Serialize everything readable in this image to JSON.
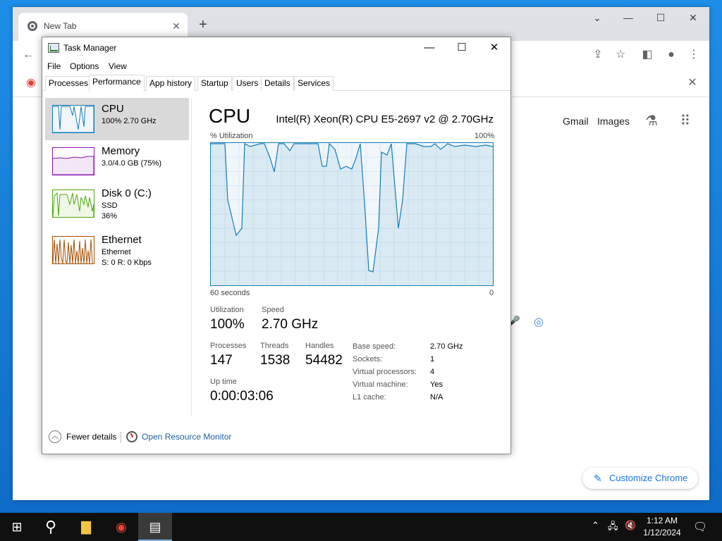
{
  "chrome": {
    "tab_title": "New Tab",
    "new_tab": "+",
    "links": [
      "Gmail",
      "Images"
    ],
    "customize_label": "Customize Chrome"
  },
  "task_manager": {
    "title": "Task Manager",
    "menu": [
      "File",
      "Options",
      "View"
    ],
    "tabs": [
      "Processes",
      "Performance",
      "App history",
      "Startup",
      "Users",
      "Details",
      "Services"
    ],
    "active_tab": "Performance",
    "resources": [
      {
        "name": "CPU",
        "sub1": "100%  2.70 GHz",
        "sub2": "",
        "color": "#117dbb"
      },
      {
        "name": "Memory",
        "sub1": "3.0/4.0 GB (75%)",
        "sub2": "",
        "color": "#8b12ae"
      },
      {
        "name": "Disk 0 (C:)",
        "sub1": "SSD",
        "sub2": "36%",
        "color": "#4da60c"
      },
      {
        "name": "Ethernet",
        "sub1": "Ethernet",
        "sub2": "S: 0  R: 0 Kbps",
        "color": "#a74f01"
      }
    ],
    "cpu": {
      "title": "CPU",
      "model": "Intel(R) Xeon(R) CPU E5-2697 v2 @ 2.70GHz",
      "graph_label": "% Utilization",
      "graph_max": "100%",
      "graph_time": "60 seconds",
      "graph_min": "0",
      "utilization_label": "Utilization",
      "utilization": "100%",
      "speed_label": "Speed",
      "speed": "2.70 GHz",
      "processes_label": "Processes",
      "processes": "147",
      "threads_label": "Threads",
      "threads": "1538",
      "handles_label": "Handles",
      "handles": "54482",
      "uptime_label": "Up time",
      "uptime": "0:00:03:06",
      "specs": [
        {
          "label": "Base speed:",
          "value": "2.70 GHz"
        },
        {
          "label": "Sockets:",
          "value": "1"
        },
        {
          "label": "Virtual processors:",
          "value": "4"
        },
        {
          "label": "Virtual machine:",
          "value": "Yes"
        },
        {
          "label": "L1 cache:",
          "value": "N/A"
        }
      ],
      "history": [
        100,
        100,
        100,
        100,
        100,
        100,
        100,
        100,
        100,
        60,
        40,
        45,
        100,
        100,
        100,
        97,
        96,
        100,
        90,
        85,
        93,
        97,
        95,
        100,
        100,
        100,
        90,
        85,
        100,
        100,
        100,
        100,
        100,
        100,
        100,
        100,
        100,
        100,
        100,
        100,
        98,
        100,
        100,
        100,
        100,
        100,
        100,
        100,
        100,
        100,
        100,
        100,
        100,
        100,
        100,
        100,
        100,
        100,
        100,
        100,
        100,
        100,
        100,
        100,
        100,
        100
      ]
    },
    "footer": {
      "fewer_details": "Fewer details",
      "resource_monitor": "Open Resource Monitor"
    }
  },
  "taskbar": {
    "time": "1:12 AM",
    "date": "1/12/2024"
  }
}
